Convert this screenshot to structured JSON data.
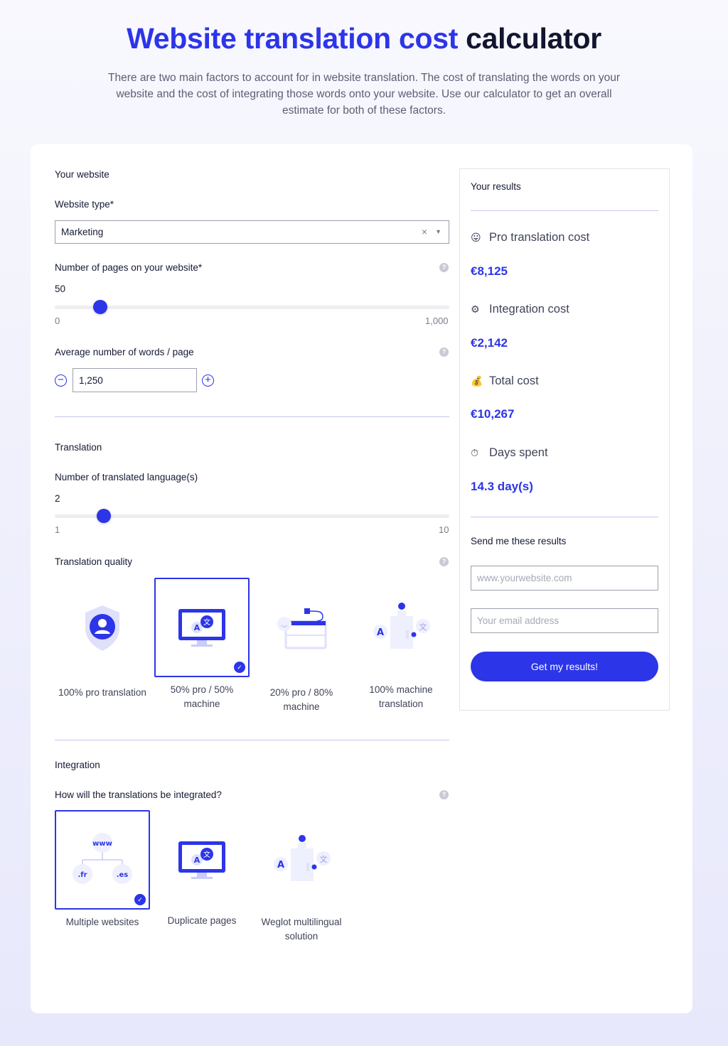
{
  "header": {
    "title_accent": "Website translation cost",
    "title_rest": "calculator",
    "description": "There are two main factors to account for in website translation. The cost of translating the words on your website and the cost of integrating those words onto your website. Use our calculator to get an overall estimate for both of these factors."
  },
  "website": {
    "section_title": "Your website",
    "type_label": "Website type*",
    "type_value": "Marketing",
    "pages_label": "Number of pages on your website*",
    "pages_value": "50",
    "pages_min": "0",
    "pages_max": "1,000",
    "pages_fraction": 0.05,
    "words_label": "Average number of words / page",
    "words_value": "1,250"
  },
  "translation": {
    "section_title": "Translation",
    "languages_label": "Number of translated language(s)",
    "languages_value": "2",
    "languages_min": "1",
    "languages_max": "10",
    "languages_fraction": 0.111,
    "quality_label": "Translation quality",
    "options": [
      {
        "label": "100% pro translation",
        "selected": false
      },
      {
        "label": "50% pro / 50% machine",
        "selected": true
      },
      {
        "label": "20% pro / 80% machine",
        "selected": false
      },
      {
        "label": "100% machine translation",
        "selected": false
      }
    ]
  },
  "integration": {
    "section_title": "Integration",
    "question": "How will the translations be integrated?",
    "options": [
      {
        "label": "Multiple websites",
        "selected": true
      },
      {
        "label": "Duplicate pages",
        "selected": false
      },
      {
        "label": "Weglot multilingual solution",
        "selected": false
      }
    ],
    "diagram": {
      "top": "www",
      "left": ".fr",
      "right": ".es"
    }
  },
  "results": {
    "title": "Your results",
    "pro_label": "Pro translation cost",
    "pro_value": "€8,125",
    "integration_label": "Integration cost",
    "integration_value": "€2,142",
    "total_label": "Total cost",
    "total_value": "€10,267",
    "days_label": "Days spent",
    "days_value": "14.3 day(s)",
    "send_title": "Send me these results",
    "website_placeholder": "www.yourwebsite.com",
    "email_placeholder": "Your email address",
    "cta": "Get my results!"
  },
  "icons": {
    "help": "question-mark-icon",
    "pro": "tongue-face-icon",
    "integration": "gear-icon",
    "total": "money-bag-icon",
    "days": "stopwatch-icon"
  },
  "colors": {
    "accent": "#2c35e8",
    "text": "#141a33",
    "muted": "#7a7e8c"
  }
}
